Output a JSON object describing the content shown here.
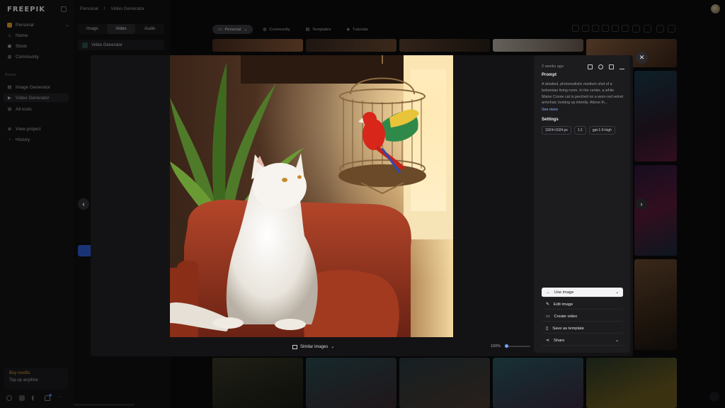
{
  "app": {
    "logo": "FREEPIK"
  },
  "breadcrumb": [
    "Personal",
    "/",
    "Video Generator"
  ],
  "sidebar": {
    "workspace": "Personal",
    "nav": [
      "Home",
      "Stock",
      "Community"
    ],
    "section_pinned": "Pinned",
    "pinned": [
      "Image Generator",
      "Video Generator",
      "All tools"
    ],
    "other": [
      "View project",
      "History"
    ],
    "credits_buy": "Buy credits",
    "credits_topup": "Top up anytime"
  },
  "panel": {
    "tabs": [
      "Image",
      "Video",
      "Audio"
    ],
    "active_tab": "Video",
    "tool": "Video Generator"
  },
  "filters": {
    "chips": [
      "Personal",
      "Community",
      "Templates",
      "Tutorials"
    ],
    "active": "Personal"
  },
  "detail": {
    "date": "2 weeks ago",
    "prompt_heading": "Prompt",
    "prompt": "A detailed, photorealistic medium shot of a bohemian living room. In the center, a white Maine Coone cat is perched on a worn red velvet armchair, looking up intently. Above th...",
    "see_more": "See more",
    "settings_heading": "Settings",
    "settings": [
      "1024×1024 px",
      "1:1",
      "gpt-1-5-high"
    ],
    "actions": {
      "use_image": "Use image",
      "edit_image": "Edit image",
      "create_video": "Create video",
      "save_template": "Save as template",
      "share": "Share"
    },
    "similar": "Similar images",
    "zoom": "100%",
    "zoom_level": 0
  },
  "colors": {
    "accent": "#7aa2ff",
    "credits": "#e0a030",
    "primary_btn": "#f3f3f5"
  }
}
